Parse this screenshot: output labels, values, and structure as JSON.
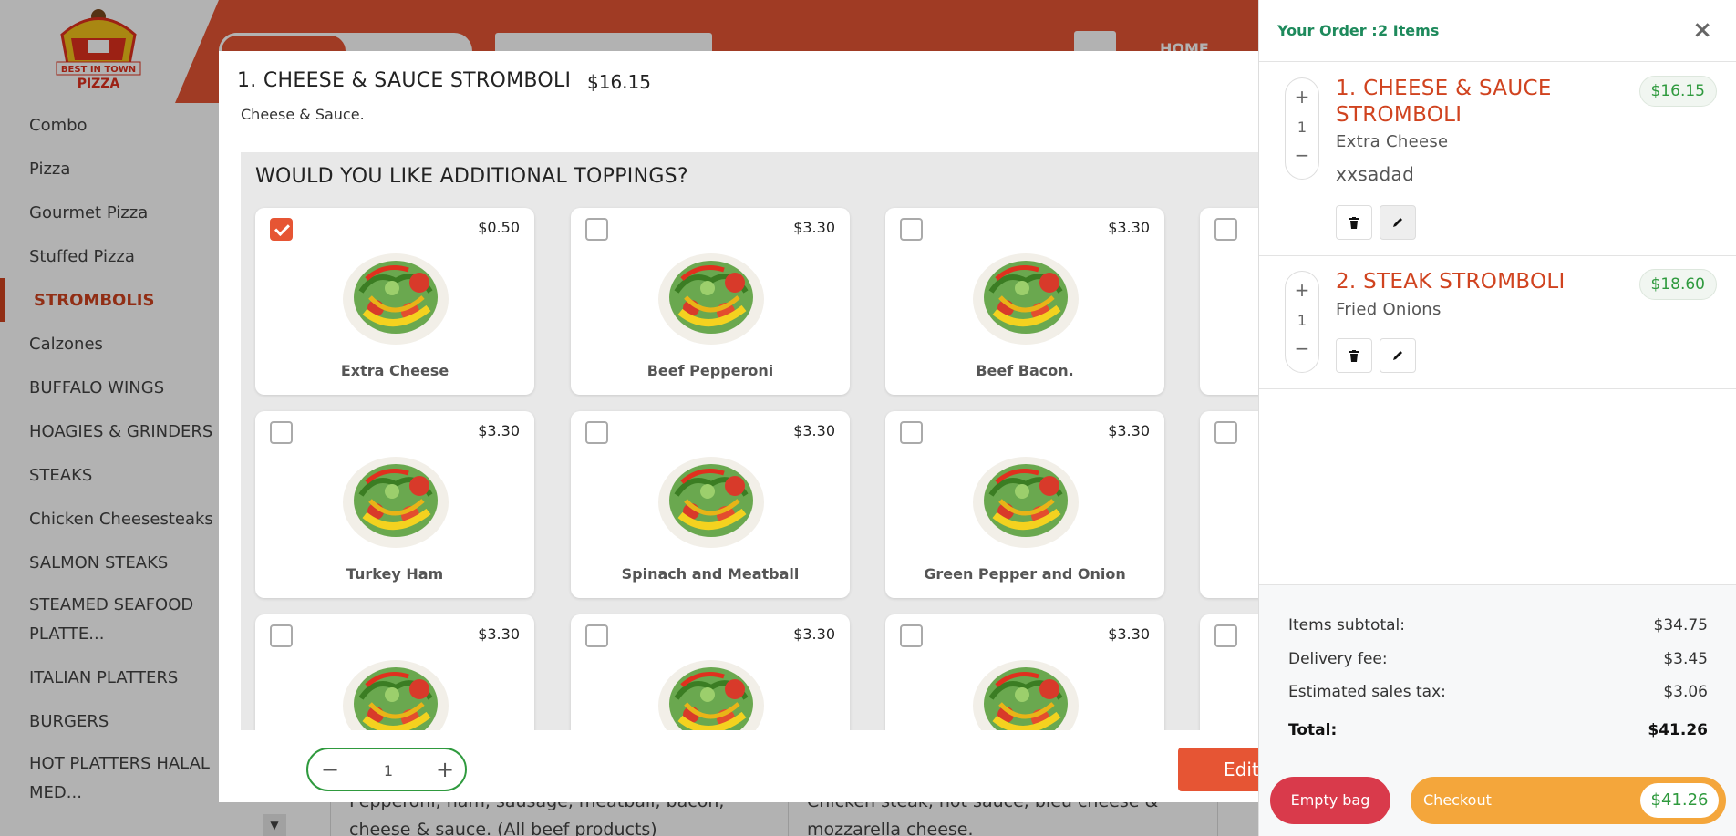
{
  "header": {
    "logo_text": "BEST IN TOWN PIZZA",
    "home_label": "HOME"
  },
  "sidebar": {
    "items": [
      {
        "label": "Combo"
      },
      {
        "label": "Pizza"
      },
      {
        "label": "Gourmet Pizza"
      },
      {
        "label": "Stuffed Pizza"
      },
      {
        "label": "STROMBOLIS"
      },
      {
        "label": "Calzones"
      },
      {
        "label": "BUFFALO WINGS"
      },
      {
        "label": "HOAGIES & GRINDERS"
      },
      {
        "label": "STEAKS"
      },
      {
        "label": "Chicken Cheesesteaks"
      },
      {
        "label": "SALMON STEAKS"
      },
      {
        "label": "STEAMED SEAFOOD PLATTE..."
      },
      {
        "label": "ITALIAN PLATTERS"
      },
      {
        "label": "BURGERS"
      },
      {
        "label": "HOT PLATTERS HALAL MED..."
      }
    ]
  },
  "background_cards": [
    {
      "text": "Pepperoni, ham, sausage, meatball, bacon, cheese & sauce. (All beef products)"
    },
    {
      "text": "Chicken steak, hot sauce, bleu cheese & mozzarella cheese."
    }
  ],
  "modal": {
    "title": "1. CHEESE & SAUCE STROMBOLI",
    "price": "$16.15",
    "description": "Cheese & Sauce.",
    "toppings_heading": "WOULD YOU LIKE ADDITIONAL TOPPINGS?",
    "toppings": [
      {
        "name": "Extra Cheese",
        "price": "$0.50",
        "checked": true
      },
      {
        "name": "Beef Pepperoni",
        "price": "$3.30",
        "checked": false
      },
      {
        "name": "Beef Bacon.",
        "price": "$3.30",
        "checked": false
      },
      {
        "name": "",
        "price": "",
        "checked": false
      },
      {
        "name": "Turkey Ham",
        "price": "$3.30",
        "checked": false
      },
      {
        "name": "Spinach and Meatball",
        "price": "$3.30",
        "checked": false
      },
      {
        "name": "Green Pepper and Onion",
        "price": "$3.30",
        "checked": false
      },
      {
        "name": "",
        "price": "",
        "checked": false
      },
      {
        "name": "",
        "price": "$3.30",
        "checked": false
      },
      {
        "name": "",
        "price": "$3.30",
        "checked": false
      },
      {
        "name": "",
        "price": "$3.30",
        "checked": false
      },
      {
        "name": "",
        "price": "",
        "checked": false
      }
    ],
    "quantity": "1",
    "minus_label": "−",
    "plus_label": "+",
    "edit_label": "Edit"
  },
  "cart": {
    "title": "Your Order :",
    "count": "2 Items",
    "close_icon": "×",
    "items": [
      {
        "name_line1": "1. CHEESE & SAUCE",
        "name_line2": "STROMBOLI",
        "price": "$16.15",
        "qty": "1",
        "option": "Extra Cheese",
        "note": "xxsadad"
      },
      {
        "name_line1": "2. STEAK STROMBOLI",
        "price": "$18.60",
        "qty": "1",
        "option": "Fried Onions"
      }
    ],
    "summary": {
      "subtotal_label": "Items subtotal:",
      "subtotal": "$34.75",
      "delivery_label": "Delivery fee:",
      "delivery": "$3.45",
      "tax_label": "Estimated sales tax:",
      "tax": "$3.06",
      "total_label": "Total:",
      "total": "$41.26"
    },
    "empty_bag_label": "Empty bag",
    "checkout_label": "Checkout",
    "checkout_total": "$41.26"
  },
  "colors": {
    "brand": "#e65534",
    "accent_green": "#2f9a3e",
    "cart_item_name": "#d0431f",
    "empty_bag": "#d93a4b",
    "checkout": "#f4a63b"
  }
}
